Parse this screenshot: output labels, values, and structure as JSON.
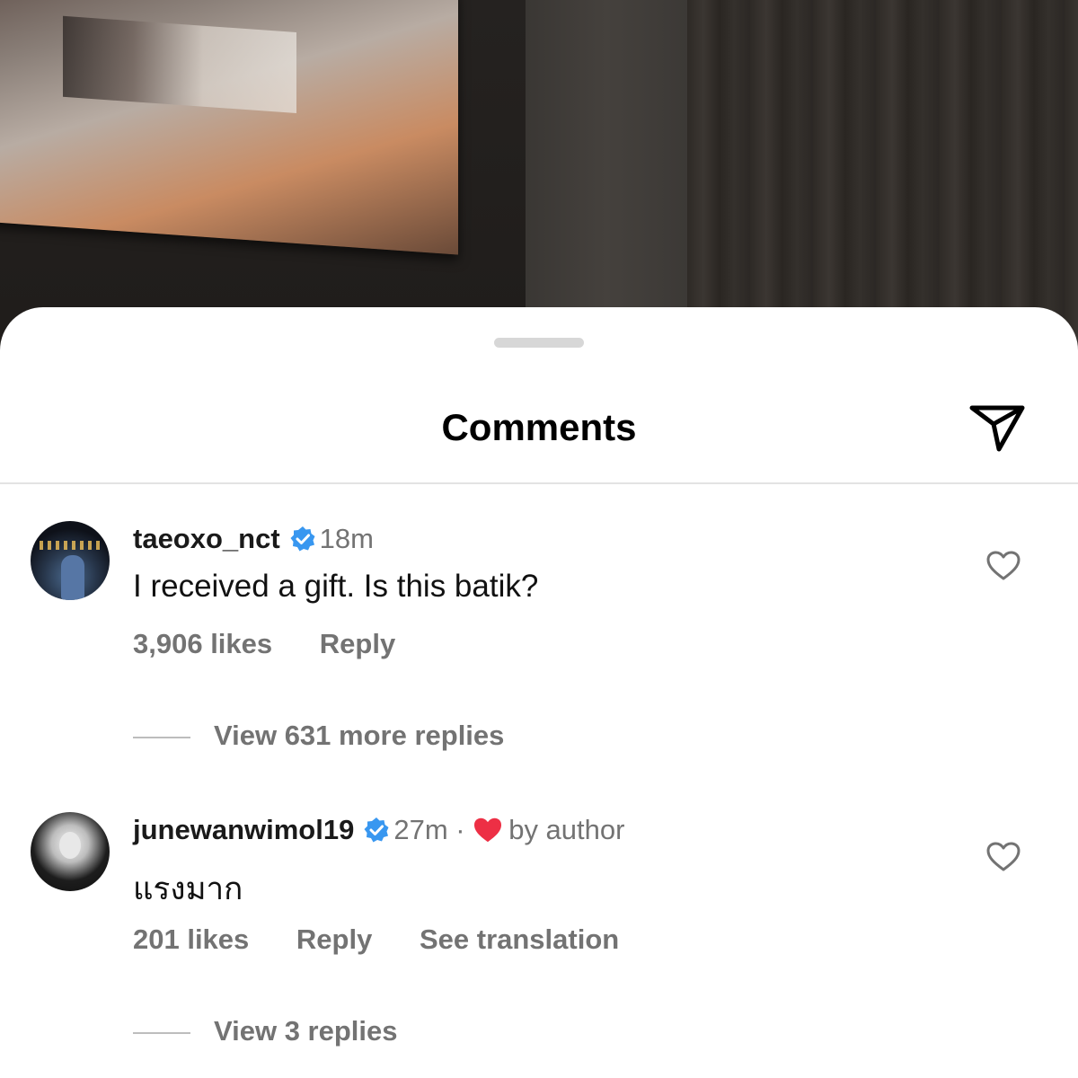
{
  "sheet": {
    "title": "Comments",
    "share_icon": "paper-plane-icon"
  },
  "comments": [
    {
      "username": "taeoxo_nct",
      "verified": true,
      "time": "18m",
      "text": "I received a gift. Is this batik?",
      "likes": "3,906 likes",
      "reply": "Reply",
      "view_replies": "View 631 more replies"
    },
    {
      "username": "junewanwimol19",
      "verified": true,
      "time": "27m · ",
      "liked_by_author": "by author",
      "text": "แรงมาก",
      "likes": "201 likes",
      "reply": "Reply",
      "see_translation": "See translation",
      "view_replies": "View 3 replies"
    }
  ],
  "colors": {
    "verified_blue": "#3897f0",
    "heart_red": "#ed2f45",
    "secondary_text": "#737373"
  }
}
